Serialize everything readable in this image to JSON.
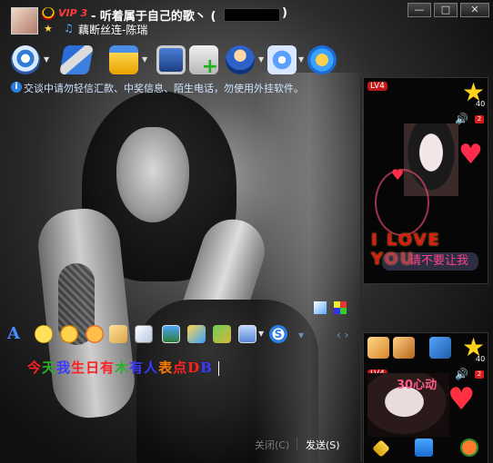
{
  "window": {
    "vip_label": "VIP 3",
    "title": "- 听着属于自己的歌丶 (",
    "title_close": ")",
    "signature": "藕断丝连-陈瑞",
    "buttons": {
      "minimize": "—",
      "maximize": "□",
      "close": "✕"
    }
  },
  "notice": {
    "icon": "i",
    "text": "交谈中请勿轻信汇款、中奖信息、陌生电话，勿使用外挂软件。"
  },
  "format_bar": {
    "font_glyph": "A",
    "s_glyph": "S"
  },
  "composer": {
    "message": [
      "今",
      "天",
      "我",
      "生",
      "日",
      "有",
      "木",
      "有",
      "人",
      "表",
      "点",
      "D",
      "B"
    ],
    "colors": [
      "#ff2020",
      "#2bb02b",
      "#3a3aff",
      "#ff2020",
      "#ff2020",
      "#ff2020",
      "#2bb02b",
      "#3a3aff",
      "#3a3aff",
      "#ff7b00",
      "#ff2020",
      "#ff2020",
      "#3a3aff"
    ]
  },
  "actions": {
    "close_label": "关闭(C)",
    "send_label": "发送(S)"
  },
  "right_panel_top": {
    "level": "LV4",
    "star_count": "40",
    "speaker_badge": "2",
    "love_text": "I LOVE YOU",
    "message": "请不要让我"
  },
  "right_panel_bottom": {
    "level": "LV4",
    "star_count": "40",
    "speaker_badge": "2",
    "overlay_text": "30心动"
  },
  "icons": {
    "toolbar": [
      "video-call-icon",
      "voice-call-icon",
      "send-file-icon",
      "remote-desktop-icon",
      "add-app-icon",
      "create-group-icon",
      "app-settings-icon",
      "share-icon"
    ],
    "format": [
      "font-icon",
      "emoji-icon",
      "magic-face-icon",
      "shake-icon",
      "handwriting-icon",
      "image-icon",
      "send-image-icon",
      "picture-icon",
      "screenshot-icon",
      "soso-icon"
    ]
  }
}
